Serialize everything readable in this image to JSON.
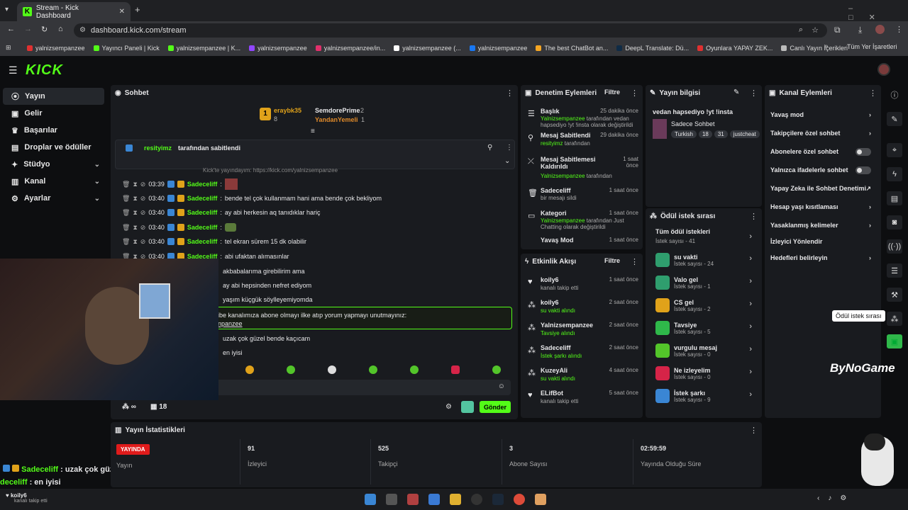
{
  "browser": {
    "tab_title": "Stream - Kick Dashboard",
    "url": "dashboard.kick.com/stream",
    "bookmarks": [
      "yalnizsempanzee",
      "Yayıncı Paneli | Kick",
      "yalnizsempanzee | K...",
      "yalnizsempanzee",
      "yalnizsempanzee/in...",
      "yalnizsempanzee (...",
      "yalnizsempanzee",
      "The best ChatBot an...",
      "DeepL Translate: Dü...",
      "Oyunlara YAPAY ZEK...",
      "Canlı Yayın İçerikleri"
    ],
    "bookmarks_more": "Tüm Yer İşaretleri",
    "colors": {
      "accent": "#53fc18"
    }
  },
  "brand": {
    "logo": "KICK"
  },
  "sidebar": {
    "items": [
      {
        "label": "Yayın"
      },
      {
        "label": "Gelir"
      },
      {
        "label": "Başarılar"
      },
      {
        "label": "Droplar ve ödüller"
      },
      {
        "label": "Stüdyo"
      },
      {
        "label": "Kanal"
      },
      {
        "label": "Ayarlar"
      }
    ]
  },
  "chat": {
    "title": "Sohbet",
    "top": [
      {
        "rank": "1",
        "name": "eraybk35",
        "count": "8"
      },
      {
        "name": "SemdorePrime",
        "count": "2"
      },
      {
        "name": "YandanYemeli",
        "count": "1"
      }
    ],
    "pinned": {
      "by": "resityimz",
      "text": "tarafından sabitlendi"
    },
    "partial_line": "Kick'te yayındayım: https://kick.com/yalnizsempanzee",
    "messages": [
      {
        "time": "03:39",
        "user": "Sadeceliff",
        "text": ""
      },
      {
        "time": "03:40",
        "user": "Sadeceliff",
        "text": "bende tel çok kullanmam hani ama bende çok bekliyom"
      },
      {
        "time": "03:40",
        "user": "Sadeceliff",
        "text": "ay abi herkesin aq tanıdıklar hariç"
      },
      {
        "time": "03:40",
        "user": "Sadeceliff",
        "text": ""
      },
      {
        "time": "03:40",
        "user": "Sadeceliff",
        "text": "tel ekran sürem 15 dk olabilir"
      },
      {
        "time": "03:40",
        "user": "Sadeceliff",
        "text": "abi ufaktan alımasınlar"
      },
      {
        "text": "akbabalarıma girebilirim ama"
      },
      {
        "text": "ay abi hepsinden nefret ediyom"
      },
      {
        "text": "yaşım küçgük söylleyemiyomda"
      }
    ],
    "highlight": {
      "line1": "ibe kanalımıza abone olmayı ilke atıp yorum yapmayı unutmayınız:",
      "line2": "npanzee"
    },
    "after": [
      {
        "text": "uzak çok güzel bende kaçıcam"
      },
      {
        "text": "en iyisi"
      }
    ],
    "footer": {
      "infinity": "∞",
      "count": "18",
      "send": "Gönder"
    }
  },
  "overlay": {
    "user": "Sadeceliff",
    "text": "uzak çok güzel bende kaçıcam",
    "user2": "deceliff",
    "text2": "en iyisi",
    "notify_user": "koily6",
    "notify_text": "kanalı takip etti"
  },
  "mod": {
    "title": "Denetim Eylemleri",
    "filter": "Filtre",
    "items": [
      {
        "title": "Başlık",
        "time": "25 dakika önce",
        "sub_user": "Yalnizsempanzee",
        "sub": "tarafından vedan hapsediyo !yt !insta olarak değiştirildi"
      },
      {
        "title": "Mesaj Sabitlendi",
        "time": "29 dakika önce",
        "sub_user": "resityimz",
        "sub": "tarafından"
      },
      {
        "title": "Mesaj Sabitlemesi Kaldırıldı",
        "time": "1 saat önce",
        "sub_user": "Yalnizsempanzee",
        "sub": "tarafından"
      },
      {
        "title": "Sadeceliff",
        "time": "1 saat önce",
        "sub_user": "",
        "sub": "bir mesajı sildi"
      },
      {
        "title": "Kategori",
        "time": "1 saat önce",
        "sub_user": "Yalnizsempanzee",
        "sub": "tarafından Just Chatting olarak değiştirildi"
      },
      {
        "title": "Yavaş Mod",
        "time": "1 saat önce",
        "sub_user": "",
        "sub": ""
      }
    ]
  },
  "activity": {
    "title": "Etkinlik Akışı",
    "filter": "Filtre",
    "items": [
      {
        "title": "koily6",
        "time": "1 saat önce",
        "sub": "kanalı takip etti"
      },
      {
        "title": "koily6",
        "time": "2 saat önce",
        "sub": "su vakti alındı"
      },
      {
        "title": "Yalnizsempanzee",
        "time": "2 saat önce",
        "sub": "Tavsiye alındı"
      },
      {
        "title": "Sadeceliff",
        "time": "2 saat önce",
        "sub": "İstek şarkı alındı"
      },
      {
        "title": "KuzeyAli",
        "time": "4 saat önce",
        "sub": "su vakti alındı"
      },
      {
        "title": "ELifBot",
        "time": "5 saat önce",
        "sub": "kanalı takip etti"
      }
    ]
  },
  "streaminfo": {
    "title": "Yayın bilgisi",
    "stream_title": "vedan hapsediyo !yt !insta",
    "category": "Sadece Sohbet",
    "tags": [
      "Turkish",
      "18",
      "31",
      "justcheat"
    ]
  },
  "rewards": {
    "title": "Ödül istek sırası",
    "all": "Tüm ödül istekleri",
    "all_count": "İstek sayısı - 41",
    "items": [
      {
        "name": "su vakti",
        "count": "İstek sayısı - 24",
        "color": "#2f9e6e"
      },
      {
        "name": "Valo gel",
        "count": "İstek sayısı - 1",
        "color": "#2f9e6e"
      },
      {
        "name": "CS gel",
        "count": "İstek sayısı - 2",
        "color": "#e0a21a"
      },
      {
        "name": "Tavsiye",
        "count": "İstek sayısı - 5",
        "color": "#2fb84a"
      },
      {
        "name": "vurgulu mesaj",
        "count": "İstek sayısı - 0",
        "color": "#53c52a"
      },
      {
        "name": "Ne izleyelim",
        "count": "İstek sayısı - 0",
        "color": "#d62448"
      },
      {
        "name": "İstek şarkı",
        "count": "İstek sayısı - 9",
        "color": "#3a86d4"
      }
    ]
  },
  "channel": {
    "title": "Kanal Eylemleri",
    "items": [
      {
        "label": "Yavaş mod",
        "type": "arrow"
      },
      {
        "label": "Takipçilere özel sohbet",
        "type": "arrow"
      },
      {
        "label": "Abonelere özel sohbet",
        "type": "toggle"
      },
      {
        "label": "Yalnızca ifadelerle sohbet",
        "type": "toggle"
      },
      {
        "label": "Yapay Zeka ile Sohbet Denetimi",
        "type": "ext"
      },
      {
        "label": "Hesap yaşı kısıtlaması",
        "type": "arrow"
      },
      {
        "label": "Yasaklanmış kelimeler",
        "type": "arrow"
      },
      {
        "label": "İzleyici Yönlendir",
        "type": "none"
      },
      {
        "label": "Hedefleri belirleyin",
        "type": "arrow"
      }
    ]
  },
  "tooltip": "Ödül istek sırası",
  "watermark": "ByNoGame",
  "stats": {
    "title": "Yayın İstatistikleri",
    "live": "YAYINDA",
    "live_sub": "Yayın",
    "items": [
      {
        "value": "91",
        "label": "İzleyici"
      },
      {
        "value": "525",
        "label": "Takipçi"
      },
      {
        "value": "3",
        "label": "Abone Sayısı"
      },
      {
        "value": "02:59:59",
        "label": "Yayında Olduğu Süre"
      }
    ]
  }
}
